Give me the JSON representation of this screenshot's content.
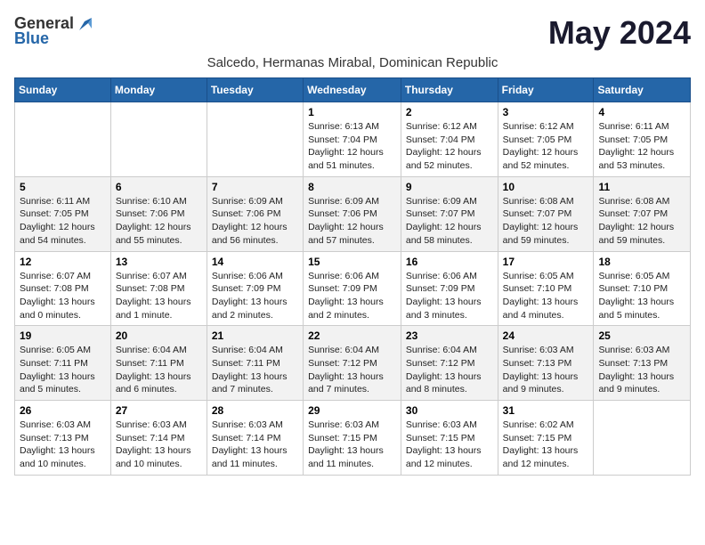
{
  "logo": {
    "general": "General",
    "blue": "Blue"
  },
  "title": "May 2024",
  "subtitle": "Salcedo, Hermanas Mirabal, Dominican Republic",
  "days_of_week": [
    "Sunday",
    "Monday",
    "Tuesday",
    "Wednesday",
    "Thursday",
    "Friday",
    "Saturday"
  ],
  "weeks": [
    [
      {
        "day": "",
        "info": ""
      },
      {
        "day": "",
        "info": ""
      },
      {
        "day": "",
        "info": ""
      },
      {
        "day": "1",
        "info": "Sunrise: 6:13 AM\nSunset: 7:04 PM\nDaylight: 12 hours\nand 51 minutes."
      },
      {
        "day": "2",
        "info": "Sunrise: 6:12 AM\nSunset: 7:04 PM\nDaylight: 12 hours\nand 52 minutes."
      },
      {
        "day": "3",
        "info": "Sunrise: 6:12 AM\nSunset: 7:05 PM\nDaylight: 12 hours\nand 52 minutes."
      },
      {
        "day": "4",
        "info": "Sunrise: 6:11 AM\nSunset: 7:05 PM\nDaylight: 12 hours\nand 53 minutes."
      }
    ],
    [
      {
        "day": "5",
        "info": "Sunrise: 6:11 AM\nSunset: 7:05 PM\nDaylight: 12 hours\nand 54 minutes."
      },
      {
        "day": "6",
        "info": "Sunrise: 6:10 AM\nSunset: 7:06 PM\nDaylight: 12 hours\nand 55 minutes."
      },
      {
        "day": "7",
        "info": "Sunrise: 6:09 AM\nSunset: 7:06 PM\nDaylight: 12 hours\nand 56 minutes."
      },
      {
        "day": "8",
        "info": "Sunrise: 6:09 AM\nSunset: 7:06 PM\nDaylight: 12 hours\nand 57 minutes."
      },
      {
        "day": "9",
        "info": "Sunrise: 6:09 AM\nSunset: 7:07 PM\nDaylight: 12 hours\nand 58 minutes."
      },
      {
        "day": "10",
        "info": "Sunrise: 6:08 AM\nSunset: 7:07 PM\nDaylight: 12 hours\nand 59 minutes."
      },
      {
        "day": "11",
        "info": "Sunrise: 6:08 AM\nSunset: 7:07 PM\nDaylight: 12 hours\nand 59 minutes."
      }
    ],
    [
      {
        "day": "12",
        "info": "Sunrise: 6:07 AM\nSunset: 7:08 PM\nDaylight: 13 hours\nand 0 minutes."
      },
      {
        "day": "13",
        "info": "Sunrise: 6:07 AM\nSunset: 7:08 PM\nDaylight: 13 hours\nand 1 minute."
      },
      {
        "day": "14",
        "info": "Sunrise: 6:06 AM\nSunset: 7:09 PM\nDaylight: 13 hours\nand 2 minutes."
      },
      {
        "day": "15",
        "info": "Sunrise: 6:06 AM\nSunset: 7:09 PM\nDaylight: 13 hours\nand 2 minutes."
      },
      {
        "day": "16",
        "info": "Sunrise: 6:06 AM\nSunset: 7:09 PM\nDaylight: 13 hours\nand 3 minutes."
      },
      {
        "day": "17",
        "info": "Sunrise: 6:05 AM\nSunset: 7:10 PM\nDaylight: 13 hours\nand 4 minutes."
      },
      {
        "day": "18",
        "info": "Sunrise: 6:05 AM\nSunset: 7:10 PM\nDaylight: 13 hours\nand 5 minutes."
      }
    ],
    [
      {
        "day": "19",
        "info": "Sunrise: 6:05 AM\nSunset: 7:11 PM\nDaylight: 13 hours\nand 5 minutes."
      },
      {
        "day": "20",
        "info": "Sunrise: 6:04 AM\nSunset: 7:11 PM\nDaylight: 13 hours\nand 6 minutes."
      },
      {
        "day": "21",
        "info": "Sunrise: 6:04 AM\nSunset: 7:11 PM\nDaylight: 13 hours\nand 7 minutes."
      },
      {
        "day": "22",
        "info": "Sunrise: 6:04 AM\nSunset: 7:12 PM\nDaylight: 13 hours\nand 7 minutes."
      },
      {
        "day": "23",
        "info": "Sunrise: 6:04 AM\nSunset: 7:12 PM\nDaylight: 13 hours\nand 8 minutes."
      },
      {
        "day": "24",
        "info": "Sunrise: 6:03 AM\nSunset: 7:13 PM\nDaylight: 13 hours\nand 9 minutes."
      },
      {
        "day": "25",
        "info": "Sunrise: 6:03 AM\nSunset: 7:13 PM\nDaylight: 13 hours\nand 9 minutes."
      }
    ],
    [
      {
        "day": "26",
        "info": "Sunrise: 6:03 AM\nSunset: 7:13 PM\nDaylight: 13 hours\nand 10 minutes."
      },
      {
        "day": "27",
        "info": "Sunrise: 6:03 AM\nSunset: 7:14 PM\nDaylight: 13 hours\nand 10 minutes."
      },
      {
        "day": "28",
        "info": "Sunrise: 6:03 AM\nSunset: 7:14 PM\nDaylight: 13 hours\nand 11 minutes."
      },
      {
        "day": "29",
        "info": "Sunrise: 6:03 AM\nSunset: 7:15 PM\nDaylight: 13 hours\nand 11 minutes."
      },
      {
        "day": "30",
        "info": "Sunrise: 6:03 AM\nSunset: 7:15 PM\nDaylight: 13 hours\nand 12 minutes."
      },
      {
        "day": "31",
        "info": "Sunrise: 6:02 AM\nSunset: 7:15 PM\nDaylight: 13 hours\nand 12 minutes."
      },
      {
        "day": "",
        "info": ""
      }
    ]
  ]
}
